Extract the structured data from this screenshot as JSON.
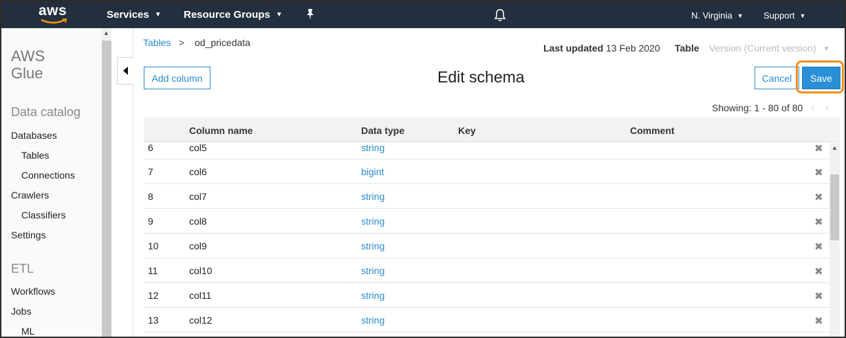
{
  "topnav": {
    "logo_text": "aws",
    "services": "Services",
    "resource_groups": "Resource Groups",
    "region": "N. Virginia",
    "support": "Support",
    "bg_color": "#232f3e"
  },
  "sidebar": {
    "title_line1": "AWS",
    "title_line2": "Glue",
    "section_data_catalog": "Data catalog",
    "databases": "Databases",
    "tables": "Tables",
    "connections": "Connections",
    "crawlers": "Crawlers",
    "classifiers": "Classifiers",
    "settings": "Settings",
    "section_etl": "ETL",
    "workflows": "Workflows",
    "jobs": "Jobs",
    "ml": "ML"
  },
  "breadcrumb": {
    "parent": "Tables",
    "separator": ">",
    "current": "od_pricedata"
  },
  "meta": {
    "last_updated_label": "Last updated",
    "last_updated_value": "13 Feb 2020",
    "table_label": "Table",
    "version_placeholder": "Version (Current version)"
  },
  "toolbar": {
    "add_column": "Add column",
    "title": "Edit schema",
    "cancel": "Cancel",
    "save": "Save",
    "accent_color": "#2a8bcb",
    "highlight_color": "#f0901f"
  },
  "pagination": {
    "showing": "Showing: 1 - 80 of 80",
    "prev": "‹",
    "next": "›"
  },
  "table": {
    "headers": {
      "column_name": "Column name",
      "data_type": "Data type",
      "key": "Key",
      "comment": "Comment"
    },
    "rows": [
      {
        "num": "6",
        "name": "col5",
        "type": "string"
      },
      {
        "num": "7",
        "name": "col6",
        "type": "bigint"
      },
      {
        "num": "8",
        "name": "col7",
        "type": "string"
      },
      {
        "num": "9",
        "name": "col8",
        "type": "string"
      },
      {
        "num": "10",
        "name": "col9",
        "type": "string"
      },
      {
        "num": "11",
        "name": "col10",
        "type": "string"
      },
      {
        "num": "12",
        "name": "col11",
        "type": "string"
      },
      {
        "num": "13",
        "name": "col12",
        "type": "string"
      }
    ],
    "delete_glyph": "✖"
  }
}
